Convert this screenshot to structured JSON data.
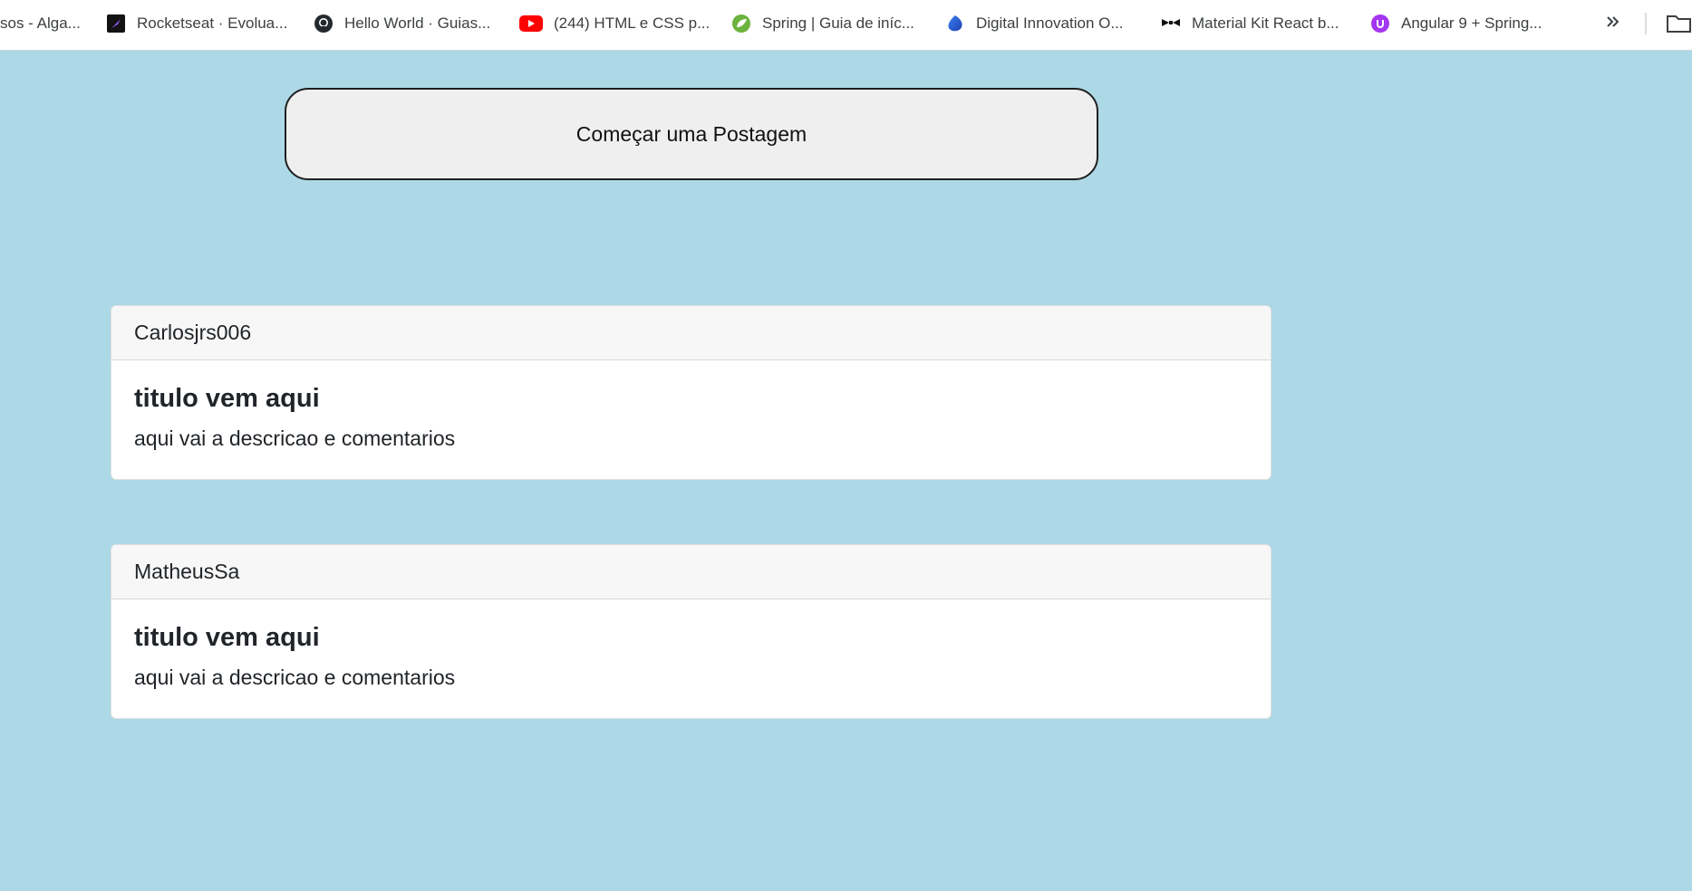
{
  "bookmarks": {
    "items": [
      {
        "label": "sos - Alga...",
        "icon": "none"
      },
      {
        "label": "Rocketseat · Evolua...",
        "icon": "rocketseat-icon"
      },
      {
        "label": "Hello World · Guias...",
        "icon": "github-icon"
      },
      {
        "label": "(244) HTML e CSS p...",
        "icon": "youtube-icon"
      },
      {
        "label": "Spring | Guia de iníc...",
        "icon": "spring-icon"
      },
      {
        "label": "Digital Innovation O...",
        "icon": "dio-icon"
      },
      {
        "label": "Material Kit React b...",
        "icon": "bow-tie-icon"
      },
      {
        "label": "Angular 9 + Spring...",
        "icon": "udemy-icon"
      }
    ]
  },
  "compose": {
    "label": "Começar uma Postagem"
  },
  "posts": [
    {
      "author": "Carlosjrs006",
      "title": "titulo vem aqui",
      "text": "aqui vai a descricao e comentarios"
    },
    {
      "author": "MatheusSa",
      "title": "titulo vem aqui",
      "text": "aqui vai a descricao e comentarios"
    }
  ],
  "colors": {
    "background": "#add8e6",
    "compose_bg": "#efefef",
    "card_header_bg": "#f7f7f7"
  }
}
